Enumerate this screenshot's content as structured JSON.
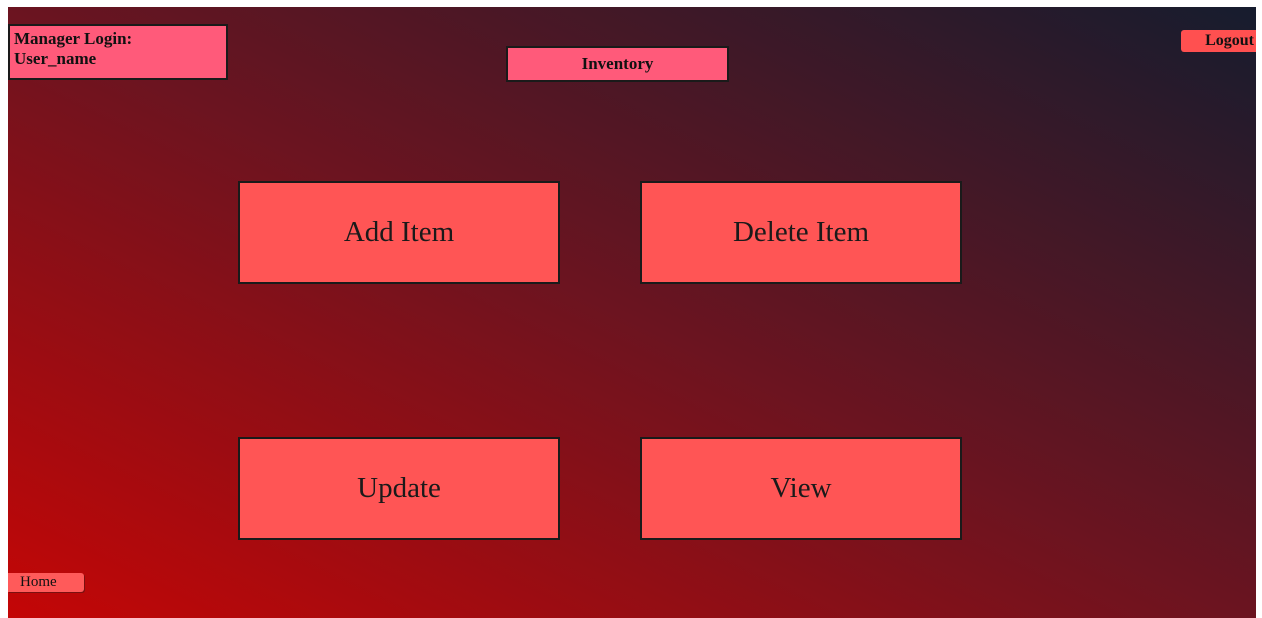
{
  "header": {
    "login_label": "Manager Login:",
    "user_name": "User_name",
    "title": "Inventory",
    "logout_label": "Logout"
  },
  "actions": {
    "add_item": "Add Item",
    "delete_item": "Delete Item",
    "update": "Update",
    "view": "View"
  },
  "footer": {
    "home_label": "Home"
  },
  "colors": {
    "gradient_start": "#c40606",
    "gradient_mid": "#6b1420",
    "gradient_end": "#161c2e",
    "box_pink": "#ff5a7a",
    "button_red": "#ff5555"
  }
}
